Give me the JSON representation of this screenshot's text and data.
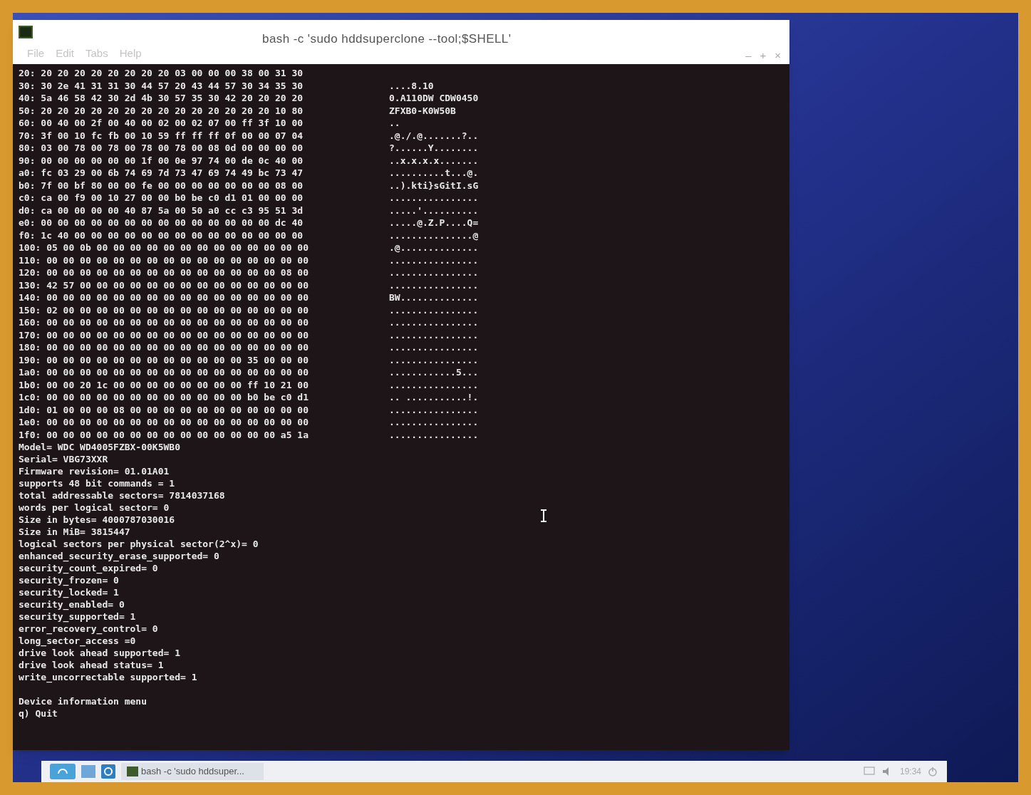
{
  "window": {
    "title": "bash -c 'sudo hddsuperclone --tool;$SHELL'",
    "menu": [
      "File",
      "Edit",
      "Tabs",
      "Help"
    ],
    "controls": [
      "–",
      "+",
      "×"
    ]
  },
  "hex_dump": [
    {
      "line": "20: 20 20 20 20 20 20 20 20 03 00 00 00 38 00 31 30"
    },
    {
      "line": "30: 30 2e 41 31 31 30 44 57 20 43 44 57 30 34 35 30",
      "ascii": "....8.10"
    },
    {
      "line": "40: 5a 46 58 42 30 2d 4b 30 57 35 30 42 20 20 20 20",
      "ascii": "0.A110DW CDW0450"
    },
    {
      "line": "50: 20 20 20 20 20 20 20 20 20 20 20 20 20 20 10 80",
      "ascii": "ZFXB0-K0W50B"
    },
    {
      "line": "60: 00 40 00 2f 00 40 00 02 00 02 07 00 ff 3f 10 00",
      "ascii": ".."
    },
    {
      "line": "70: 3f 00 10 fc fb 00 10 59 ff ff ff 0f 00 00 07 04",
      "ascii": ".@./.@.......?.."
    },
    {
      "line": "80: 03 00 78 00 78 00 78 00 78 00 08 0d 00 00 00 00",
      "ascii": "?......Y........"
    },
    {
      "line": "90: 00 00 00 00 00 00 1f 00 0e 97 74 00 de 0c 40 00",
      "ascii": "..x.x.x.x......."
    },
    {
      "line": "a0: fc 03 29 00 6b 74 69 7d 73 47 69 74 49 bc 73 47",
      "ascii": "..........t...@."
    },
    {
      "line": "b0: 7f 00 bf 80 00 00 fe 00 00 00 00 00 00 00 08 00",
      "ascii": "..).kti}sGitI.sG"
    },
    {
      "line": "c0: ca 00 f9 00 10 27 00 00 b0 be c0 d1 01 00 00 00",
      "ascii": "................"
    },
    {
      "line": "d0: ca 00 00 00 00 40 87 5a 00 50 a0 cc c3 95 51 3d",
      "ascii": ".....'.........."
    },
    {
      "line": "e0: 00 00 00 00 00 00 00 00 00 00 00 00 00 00 dc 40",
      "ascii": ".....@.Z.P....Q="
    },
    {
      "line": "f0: 1c 40 00 00 00 00 00 00 00 00 00 00 00 00 00 00",
      "ascii": "...............@"
    },
    {
      "line": "100: 05 00 0b 00 00 00 00 00 00 00 00 00 00 00 00 00",
      "ascii": ".@.............."
    },
    {
      "line": "110: 00 00 00 00 00 00 00 00 00 00 00 00 00 00 00 00",
      "ascii": "................"
    },
    {
      "line": "120: 00 00 00 00 00 00 00 00 00 00 00 00 00 00 08 00",
      "ascii": "................"
    },
    {
      "line": "130: 42 57 00 00 00 00 00 00 00 00 00 00 00 00 00 00",
      "ascii": "................"
    },
    {
      "line": "140: 00 00 00 00 00 00 00 00 00 00 00 00 00 00 00 00",
      "ascii": "BW.............."
    },
    {
      "line": "150: 02 00 00 00 00 00 00 00 00 00 00 00 00 00 00 00",
      "ascii": "................"
    },
    {
      "line": "160: 00 00 00 00 00 00 00 00 00 00 00 00 00 00 00 00",
      "ascii": "................"
    },
    {
      "line": "170: 00 00 00 00 00 00 00 00 00 00 00 00 00 00 00 00",
      "ascii": "................"
    },
    {
      "line": "180: 00 00 00 00 00 00 00 00 00 00 00 00 00 00 00 00",
      "ascii": "................"
    },
    {
      "line": "190: 00 00 00 00 00 00 00 00 00 00 00 00 35 00 00 00",
      "ascii": "................"
    },
    {
      "line": "1a0: 00 00 00 00 00 00 00 00 00 00 00 00 00 00 00 00",
      "ascii": "............5..."
    },
    {
      "line": "1b0: 00 00 20 1c 00 00 00 00 00 00 00 00 ff 10 21 00",
      "ascii": "................"
    },
    {
      "line": "1c0: 00 00 00 00 00 00 00 00 00 00 00 00 b0 be c0 d1",
      "ascii": ".. ...........!."
    },
    {
      "line": "1d0: 01 00 00 00 08 00 00 00 00 00 00 00 00 00 00 00",
      "ascii": "................"
    },
    {
      "line": "1e0: 00 00 00 00 00 00 00 00 00 00 00 00 00 00 00 00",
      "ascii": "................"
    },
    {
      "line": "1f0: 00 00 00 00 00 00 00 00 00 00 00 00 00 00 a5 1a",
      "ascii": "................"
    }
  ],
  "info_lines": [
    "Model= WDC WD4005FZBX-00K5WB0",
    "Serial= VBG73XXR",
    "Firmware revision= 01.01A01",
    "supports 48 bit commands = 1",
    "total addressable sectors= 7814037168",
    "words per logical sector= 0",
    "Size in bytes= 4000787030016",
    "Size in MiB= 3815447",
    "logical sectors per physical sector(2^x)= 0",
    "enhanced_security_erase_supported= 0",
    "security_count_expired= 0",
    "security_frozen= 0",
    "security_locked= 1",
    "security_enabled= 0",
    "security_supported= 1",
    "error_recovery_control= 0",
    "long_sector_access =0",
    "drive look ahead supported= 1",
    "drive look ahead status= 1",
    "write_uncorrectable supported= 1"
  ],
  "menu_lines": [
    "Device information menu",
    "q) Quit"
  ],
  "taskbar": {
    "task": "bash -c 'sudo hddsuper...",
    "clock": "19:34"
  }
}
